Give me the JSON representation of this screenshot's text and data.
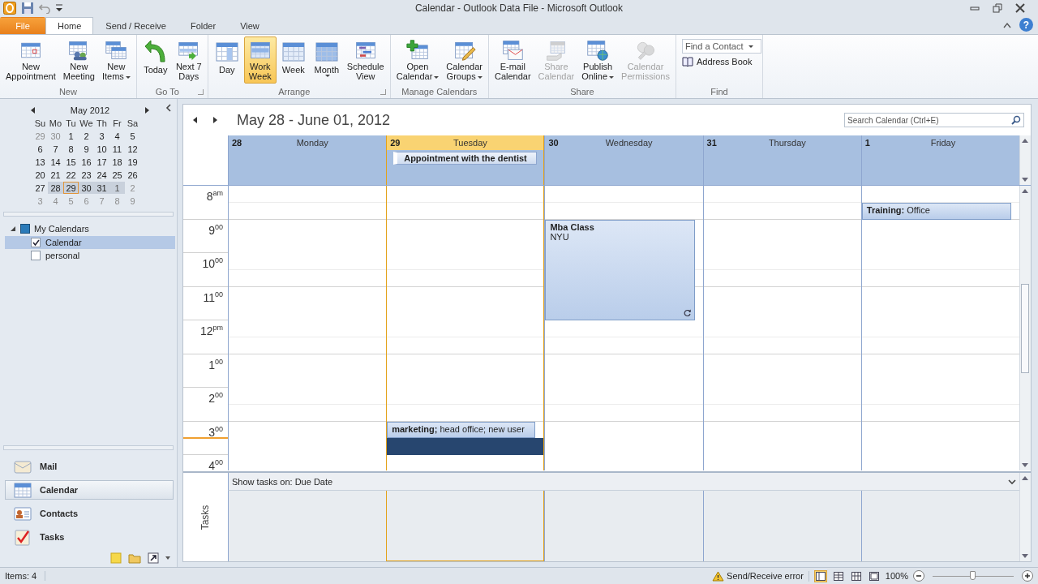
{
  "window": {
    "title": "Calendar - Outlook Data File - Microsoft Outlook"
  },
  "help": {
    "label": "?"
  },
  "ribbon_tabs": [
    {
      "label": "File",
      "kind": "file",
      "selected": false
    },
    {
      "label": "Home",
      "kind": "tab",
      "selected": true
    },
    {
      "label": "Send / Receive",
      "kind": "tab",
      "selected": false
    },
    {
      "label": "Folder",
      "kind": "tab",
      "selected": false
    },
    {
      "label": "View",
      "kind": "tab",
      "selected": false
    }
  ],
  "ribbon_groups": [
    {
      "label": "New",
      "kind": "buttons",
      "launcher": false,
      "buttons": [
        {
          "label": [
            "New",
            "Appointment"
          ],
          "dropdown": false,
          "disabled": false,
          "selected": false
        },
        {
          "label": [
            "New",
            "Meeting"
          ],
          "dropdown": false,
          "disabled": false,
          "selected": false
        },
        {
          "label": [
            "New",
            "Items"
          ],
          "dropdown": true,
          "disabled": false,
          "selected": false
        }
      ]
    },
    {
      "label": "Go To",
      "kind": "buttons",
      "launcher": true,
      "buttons": [
        {
          "label": [
            "Today"
          ],
          "dropdown": false,
          "disabled": false,
          "selected": false
        },
        {
          "label": [
            "Next 7",
            "Days"
          ],
          "dropdown": false,
          "disabled": false,
          "selected": false
        }
      ]
    },
    {
      "label": "Arrange",
      "kind": "buttons",
      "launcher": true,
      "buttons": [
        {
          "label": [
            "Day"
          ],
          "dropdown": false,
          "disabled": false,
          "selected": false
        },
        {
          "label": [
            "Work",
            "Week"
          ],
          "dropdown": false,
          "disabled": false,
          "selected": true
        },
        {
          "label": [
            "Week"
          ],
          "dropdown": false,
          "disabled": false,
          "selected": false
        },
        {
          "label": [
            "Month"
          ],
          "dropdown": true,
          "disabled": false,
          "selected": false
        },
        {
          "label": [
            "Schedule",
            "View"
          ],
          "dropdown": false,
          "disabled": false,
          "selected": false
        }
      ]
    },
    {
      "label": "Manage Calendars",
      "kind": "buttons",
      "launcher": false,
      "buttons": [
        {
          "label": [
            "Open",
            "Calendar"
          ],
          "dropdown": true,
          "disabled": false,
          "selected": false
        },
        {
          "label": [
            "Calendar",
            "Groups"
          ],
          "dropdown": true,
          "disabled": false,
          "selected": false
        }
      ]
    },
    {
      "label": "Share",
      "kind": "buttons",
      "launcher": false,
      "buttons": [
        {
          "label": [
            "E-mail",
            "Calendar"
          ],
          "dropdown": false,
          "disabled": false,
          "selected": false
        },
        {
          "label": [
            "Share",
            "Calendar"
          ],
          "dropdown": false,
          "disabled": true,
          "selected": false
        },
        {
          "label": [
            "Publish",
            "Online"
          ],
          "dropdown": true,
          "disabled": false,
          "selected": false
        },
        {
          "label": [
            "Calendar",
            "Permissions"
          ],
          "dropdown": false,
          "disabled": true,
          "selected": false
        }
      ]
    },
    {
      "label": "Find",
      "kind": "find",
      "launcher": false,
      "search": {
        "placeholder": "Find a Contact"
      },
      "link": {
        "label": "Address Book"
      }
    }
  ],
  "mini_calendar": {
    "title": "May 2012",
    "weekdays": [
      "Su",
      "Mo",
      "Tu",
      "We",
      "Th",
      "Fr",
      "Sa"
    ],
    "weeks": [
      {
        "days": [
          {
            "day": "29",
            "muted": true,
            "in_range": false,
            "selected": false
          },
          {
            "day": "30",
            "muted": true,
            "in_range": false,
            "selected": false
          },
          {
            "day": "1",
            "muted": false,
            "in_range": false,
            "selected": false
          },
          {
            "day": "2",
            "muted": false,
            "in_range": false,
            "selected": false
          },
          {
            "day": "3",
            "muted": false,
            "in_range": false,
            "selected": false
          },
          {
            "day": "4",
            "muted": false,
            "in_range": false,
            "selected": false
          },
          {
            "day": "5",
            "muted": false,
            "in_range": false,
            "selected": false
          }
        ]
      },
      {
        "days": [
          {
            "day": "6",
            "muted": false,
            "in_range": false,
            "selected": false
          },
          {
            "day": "7",
            "muted": false,
            "in_range": false,
            "selected": false
          },
          {
            "day": "8",
            "muted": false,
            "in_range": false,
            "selected": false
          },
          {
            "day": "9",
            "muted": false,
            "in_range": false,
            "selected": false
          },
          {
            "day": "10",
            "muted": false,
            "in_range": false,
            "selected": false
          },
          {
            "day": "11",
            "muted": false,
            "in_range": false,
            "selected": false
          },
          {
            "day": "12",
            "muted": false,
            "in_range": false,
            "selected": false
          }
        ]
      },
      {
        "days": [
          {
            "day": "13",
            "muted": false,
            "in_range": false,
            "selected": false
          },
          {
            "day": "14",
            "muted": false,
            "in_range": false,
            "selected": false
          },
          {
            "day": "15",
            "muted": false,
            "in_range": false,
            "selected": false
          },
          {
            "day": "16",
            "muted": false,
            "in_range": false,
            "selected": false
          },
          {
            "day": "17",
            "muted": false,
            "in_range": false,
            "selected": false
          },
          {
            "day": "18",
            "muted": false,
            "in_range": false,
            "selected": false
          },
          {
            "day": "19",
            "muted": false,
            "in_range": false,
            "selected": false
          }
        ]
      },
      {
        "days": [
          {
            "day": "20",
            "muted": false,
            "in_range": false,
            "selected": false
          },
          {
            "day": "21",
            "muted": false,
            "in_range": false,
            "selected": false
          },
          {
            "day": "22",
            "muted": false,
            "in_range": false,
            "selected": false
          },
          {
            "day": "23",
            "muted": false,
            "in_range": false,
            "selected": false
          },
          {
            "day": "24",
            "muted": false,
            "in_range": false,
            "selected": false
          },
          {
            "day": "25",
            "muted": false,
            "in_range": false,
            "selected": false
          },
          {
            "day": "26",
            "muted": false,
            "in_range": false,
            "selected": false
          }
        ]
      },
      {
        "days": [
          {
            "day": "27",
            "muted": false,
            "in_range": false,
            "selected": false
          },
          {
            "day": "28",
            "muted": false,
            "in_range": true,
            "selected": false
          },
          {
            "day": "29",
            "muted": false,
            "in_range": true,
            "selected": true
          },
          {
            "day": "30",
            "muted": false,
            "in_range": true,
            "selected": false
          },
          {
            "day": "31",
            "muted": false,
            "in_range": true,
            "selected": false
          },
          {
            "day": "1",
            "muted": true,
            "in_range": true,
            "selected": false
          },
          {
            "day": "2",
            "muted": true,
            "in_range": false,
            "selected": false
          }
        ]
      },
      {
        "days": [
          {
            "day": "3",
            "muted": true,
            "in_range": false,
            "selected": false
          },
          {
            "day": "4",
            "muted": true,
            "in_range": false,
            "selected": false
          },
          {
            "day": "5",
            "muted": true,
            "in_range": false,
            "selected": false
          },
          {
            "day": "6",
            "muted": true,
            "in_range": false,
            "selected": false
          },
          {
            "day": "7",
            "muted": true,
            "in_range": false,
            "selected": false
          },
          {
            "day": "8",
            "muted": true,
            "in_range": false,
            "selected": false
          },
          {
            "day": "9",
            "muted": true,
            "in_range": false,
            "selected": false
          }
        ]
      }
    ]
  },
  "calendar_groups": [
    {
      "label": "My Calendars",
      "expanded": true,
      "items": [
        {
          "label": "Calendar",
          "checked": true,
          "selected": true
        },
        {
          "label": "personal",
          "checked": false,
          "selected": false
        }
      ]
    }
  ],
  "nav_items": [
    {
      "label": "Mail",
      "selected": false
    },
    {
      "label": "Calendar",
      "selected": true
    },
    {
      "label": "Contacts",
      "selected": false
    },
    {
      "label": "Tasks",
      "selected": false
    }
  ],
  "calendar": {
    "range_title": "May 28 - June 01, 2012",
    "search": {
      "placeholder": "Search Calendar (Ctrl+E)"
    },
    "hours": [
      {
        "label": "8$^{am}$",
        "current": false
      },
      {
        "label": "9$^{00}$",
        "current": false
      },
      {
        "label": "10$^{00}$",
        "current": false
      },
      {
        "label": "11$^{00}$",
        "current": false
      },
      {
        "label": "12$^{pm}$",
        "current": false
      },
      {
        "label": "1$^{00}$",
        "current": false
      },
      {
        "label": "2$^{00}$",
        "current": false
      },
      {
        "label": "3$^{00}$",
        "current": true
      },
      {
        "label": "4$^{00}$",
        "current": false
      }
    ],
    "days": [
      {
        "number": "28",
        "name": "Monday",
        "today": false
      },
      {
        "number": "29",
        "name": "Tuesday",
        "today": true,
        "all_day": [
          "Appointment with the dentist"
        ],
        "slots": [
          {
            "kind": "free"
          },
          {
            "kind": "free"
          },
          {
            "kind": "free"
          },
          {
            "kind": "free"
          },
          {
            "kind": "free"
          },
          {
            "kind": "free"
          },
          {
            "kind": "free"
          },
          {
            "kind": "free"
          },
          {
            "kind": "free"
          },
          {
            "kind": "free"
          },
          {
            "kind": "free"
          },
          {
            "kind": "free"
          },
          {
            "kind": "free"
          },
          {
            "kind": "free"
          },
          {
            "kind": "event"
          },
          {
            "kind": "selected"
          },
          {
            "kind": "free"
          }
        ],
        "events": [
          {
            "text": "**marketing;** head office; new user",
            "recurring": false
          }
        ]
      },
      {
        "number": "30",
        "name": "Wednesday",
        "today": false,
        "slots": [
          {
            "kind": "free"
          },
          {
            "kind": "free"
          },
          {
            "kind": "event"
          },
          {
            "kind": "event"
          },
          {
            "kind": "event"
          },
          {
            "kind": "event"
          },
          {
            "kind": "event"
          },
          {
            "kind": "event"
          },
          {
            "kind": "free"
          },
          {
            "kind": "free"
          },
          {
            "kind": "free"
          },
          {
            "kind": "free"
          },
          {
            "kind": "free"
          },
          {
            "kind": "free"
          },
          {
            "kind": "free"
          },
          {
            "kind": "free"
          },
          {
            "kind": "free"
          }
        ],
        "events": [
          {
            "title": "Mba Class",
            "location": "NYU",
            "recurring": true
          }
        ]
      },
      {
        "number": "31",
        "name": "Thursday",
        "today": false
      },
      {
        "number": "1",
        "name": "Friday",
        "today": false,
        "slots": [
          {
            "kind": "free"
          },
          {
            "kind": "event"
          },
          {
            "kind": "free"
          },
          {
            "kind": "free"
          },
          {
            "kind": "free"
          },
          {
            "kind": "free"
          },
          {
            "kind": "free"
          },
          {
            "kind": "free"
          },
          {
            "kind": "free"
          },
          {
            "kind": "free"
          },
          {
            "kind": "free"
          },
          {
            "kind": "free"
          },
          {
            "kind": "free"
          },
          {
            "kind": "free"
          },
          {
            "kind": "free"
          },
          {
            "kind": "free"
          },
          {
            "kind": "free"
          }
        ],
        "events": [
          {
            "text": "**Training:** Office",
            "recurring": false
          }
        ]
      }
    ],
    "tasks": {
      "label": "Tasks",
      "header": "Show tasks on: Due Date"
    }
  },
  "status_bar": {
    "items": "Items: 4",
    "warning": "Send/Receive error",
    "views": [
      {
        "selected": true
      },
      {
        "selected": false
      },
      {
        "selected": false
      },
      {
        "selected": false
      }
    ],
    "zoom": "100%",
    "zoom_slider": {
      "level": 0.5
    }
  }
}
